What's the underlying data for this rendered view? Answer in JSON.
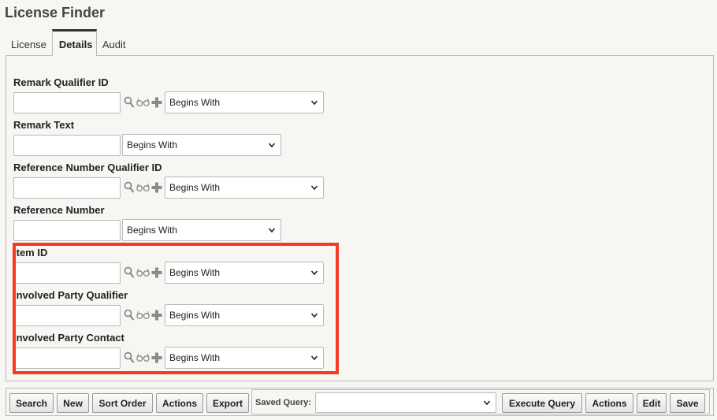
{
  "page": {
    "title": "License Finder"
  },
  "tabs": [
    {
      "label": "License"
    },
    {
      "label": "Details"
    },
    {
      "label": "Audit"
    }
  ],
  "fields": [
    {
      "label": "Remark Qualifier ID",
      "value": "",
      "operator": "Begins With",
      "has_lookup_icons": true
    },
    {
      "label": "Remark Text",
      "value": "",
      "operator": "Begins With",
      "has_lookup_icons": false
    },
    {
      "label": "Reference Number Qualifier ID",
      "value": "",
      "operator": "Begins With",
      "has_lookup_icons": true
    },
    {
      "label": "Reference Number",
      "value": "",
      "operator": "Begins With",
      "has_lookup_icons": false
    },
    {
      "label": "Item ID",
      "value": "",
      "operator": "Begins With",
      "has_lookup_icons": true
    },
    {
      "label": "Involved Party Qualifier",
      "value": "",
      "operator": "Begins With",
      "has_lookup_icons": true
    },
    {
      "label": "Involved Party Contact",
      "value": "",
      "operator": "Begins With",
      "has_lookup_icons": true
    }
  ],
  "toolbar": {
    "search": "Search",
    "new": "New",
    "sort_order": "Sort Order",
    "actions": "Actions",
    "export": "Export",
    "saved_query_label": "Saved Query:",
    "saved_query_value": "",
    "execute_query": "Execute Query",
    "actions2": "Actions",
    "edit": "Edit",
    "save": "Save"
  },
  "colors": {
    "highlight": "#f53a20",
    "background": "#f7f6f3",
    "icon": "#8a8a8a"
  },
  "icons": [
    "search-icon",
    "glasses-icon",
    "plus-icon",
    "chevron-down-icon"
  ]
}
